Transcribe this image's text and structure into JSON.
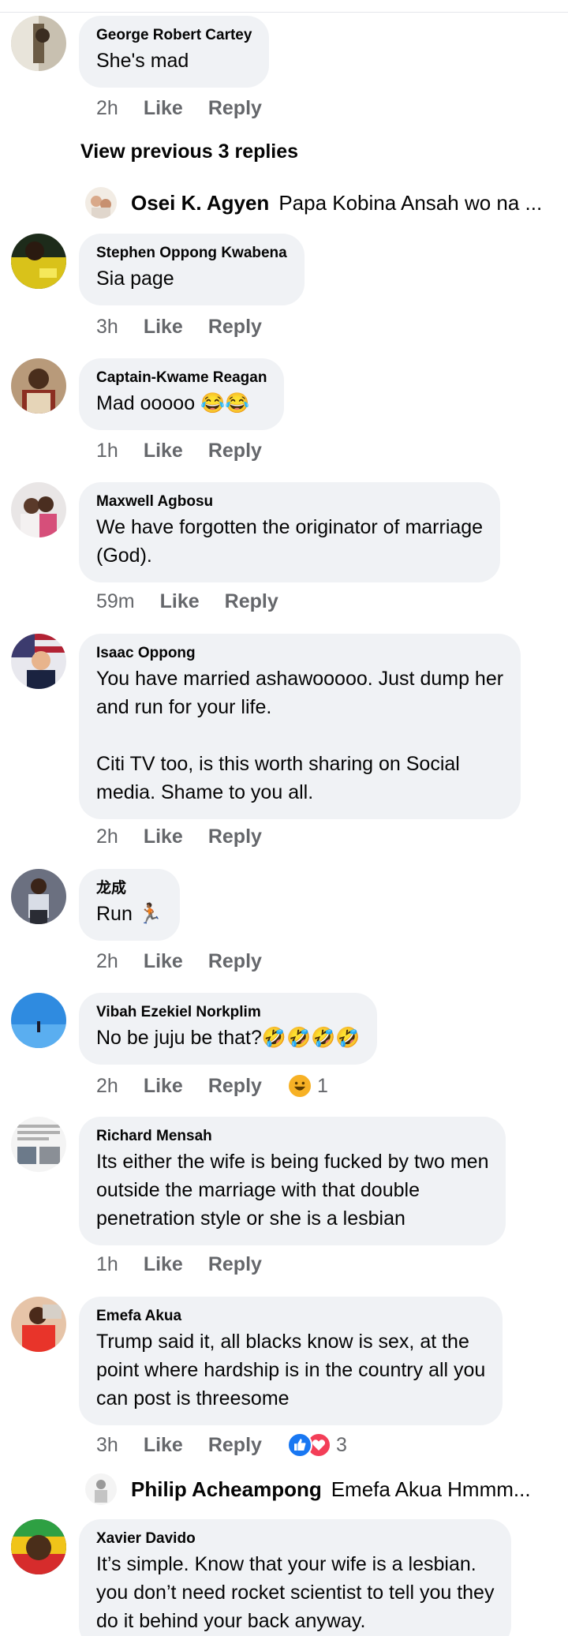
{
  "reactions": {
    "laugh": "#f7b125",
    "like": "#1877f2",
    "love": "#f33e58"
  },
  "view_previous": "View previous 3 replies",
  "replies": [
    {
      "name": "Osei K. Agyen",
      "text": "Papa Kobina Ansah wo na ..."
    },
    {
      "name": "Philip Acheampong",
      "text": "Emefa Akua Hmmm..."
    }
  ],
  "comments": [
    {
      "name": "George Robert Cartey",
      "text": "She's mad",
      "time": "2h",
      "like": "Like",
      "reply": "Reply"
    },
    {
      "name": "Stephen Oppong Kwabena",
      "text": "Sia page",
      "time": "3h",
      "like": "Like",
      "reply": "Reply"
    },
    {
      "name": "Captain-Kwame Reagan",
      "text": "Mad ooooo 😂😂",
      "time": "1h",
      "like": "Like",
      "reply": "Reply"
    },
    {
      "name": "Maxwell Agbosu",
      "text_lines": [
        "We have forgotten the originator of marriage",
        "(God)."
      ],
      "time": "59m",
      "like": "Like",
      "reply": "Reply"
    },
    {
      "name": "Isaac Oppong",
      "para1": [
        "You have married ashawooooo. Just dump her",
        "and run for your life."
      ],
      "para2": [
        "Citi TV too, is this worth sharing on Social",
        "media. Shame to you all."
      ],
      "time": "2h",
      "like": "Like",
      "reply": "Reply"
    },
    {
      "name": "龙成",
      "text": "Run 🏃🏾",
      "time": "2h",
      "like": "Like",
      "reply": "Reply"
    },
    {
      "name": "Vibah Ezekiel Norkplim",
      "text": "No be juju be that?🤣🤣🤣🤣",
      "time": "2h",
      "like": "Like",
      "reply": "Reply",
      "reaction_count": "1"
    },
    {
      "name": "Richard Mensah",
      "text_lines": [
        "Its either the wife is being fucked by two men",
        "outside the marriage with that double",
        "penetration style or she is a lesbian"
      ],
      "time": "1h",
      "like": "Like",
      "reply": "Reply"
    },
    {
      "name": "Emefa Akua",
      "text_lines": [
        "Trump said it, all blacks know is sex, at the",
        "point where hardship is in the country all you",
        "can post is threesome"
      ],
      "time": "3h",
      "like": "Like",
      "reply": "Reply",
      "reaction_count": "3"
    },
    {
      "name": "Xavier Davido",
      "text_lines": [
        "It’s simple. Know that your wife is a lesbian.",
        "you don’t need rocket scientist to tell you they",
        "do it behind your back anyway."
      ]
    }
  ]
}
